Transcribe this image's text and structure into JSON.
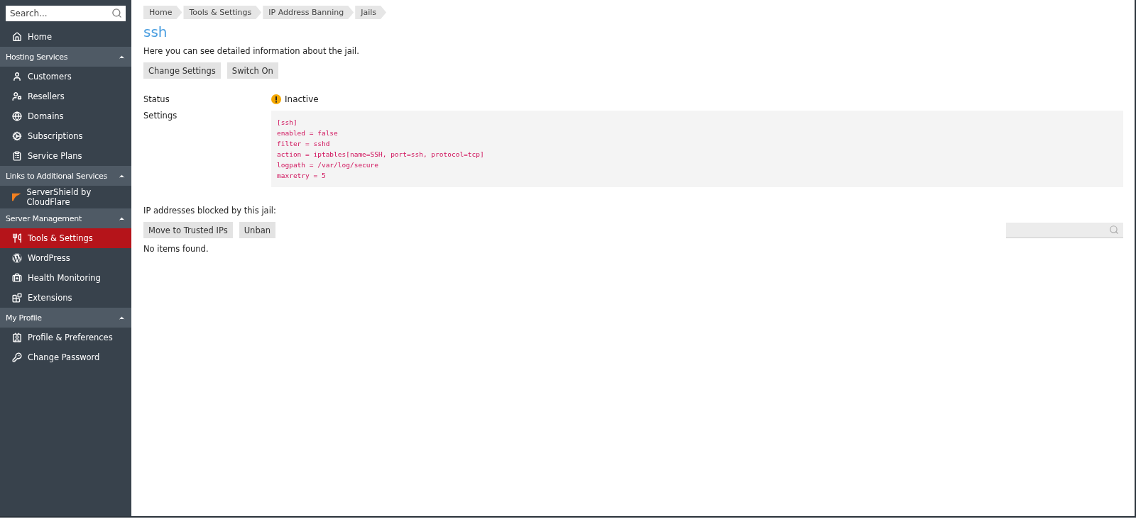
{
  "sidebar": {
    "search": {
      "placeholder": "Search..."
    },
    "top_items": [
      {
        "label": "Home",
        "selected": false
      }
    ],
    "groups": [
      {
        "title": "Hosting Services",
        "expanded": true,
        "items": [
          {
            "label": "Customers",
            "selected": false
          },
          {
            "label": "Resellers",
            "selected": false
          },
          {
            "label": "Domains",
            "selected": false
          },
          {
            "label": "Subscriptions",
            "selected": false
          },
          {
            "label": "Service Plans",
            "selected": false
          }
        ]
      },
      {
        "title": "Links to Additional Services",
        "expanded": true,
        "items": [
          {
            "label": "ServerShield by CloudFlare",
            "selected": false
          }
        ]
      },
      {
        "title": "Server Management",
        "expanded": true,
        "items": [
          {
            "label": "Tools & Settings",
            "selected": true
          },
          {
            "label": "WordPress",
            "selected": false
          },
          {
            "label": "Health Monitoring",
            "selected": false
          },
          {
            "label": "Extensions",
            "selected": false
          }
        ]
      },
      {
        "title": "My Profile",
        "expanded": true,
        "items": [
          {
            "label": "Profile & Preferences",
            "selected": false
          },
          {
            "label": "Change Password",
            "selected": false
          }
        ]
      }
    ]
  },
  "breadcrumbs": [
    "Home",
    "Tools & Settings",
    "IP Address Banning",
    "Jails"
  ],
  "title": "ssh",
  "description": "Here you can see detailed information about the jail.",
  "actions": [
    "Change Settings",
    "Switch On"
  ],
  "details": [
    {
      "kind": "status",
      "label": "Status",
      "value": "Inactive"
    },
    {
      "kind": "code",
      "label": "Settings",
      "lines": [
        "[ssh]",
        "enabled = false",
        "filter = sshd",
        "action = iptables[name=SSH, port=ssh, protocol=tcp]",
        "logpath = /var/log/secure",
        "maxretry = 5"
      ]
    }
  ],
  "blocked": {
    "heading": "IP addresses blocked by this jail:",
    "buttons": [
      "Move to Trusted IPs",
      "Unban"
    ],
    "empty_text": "No items found."
  }
}
